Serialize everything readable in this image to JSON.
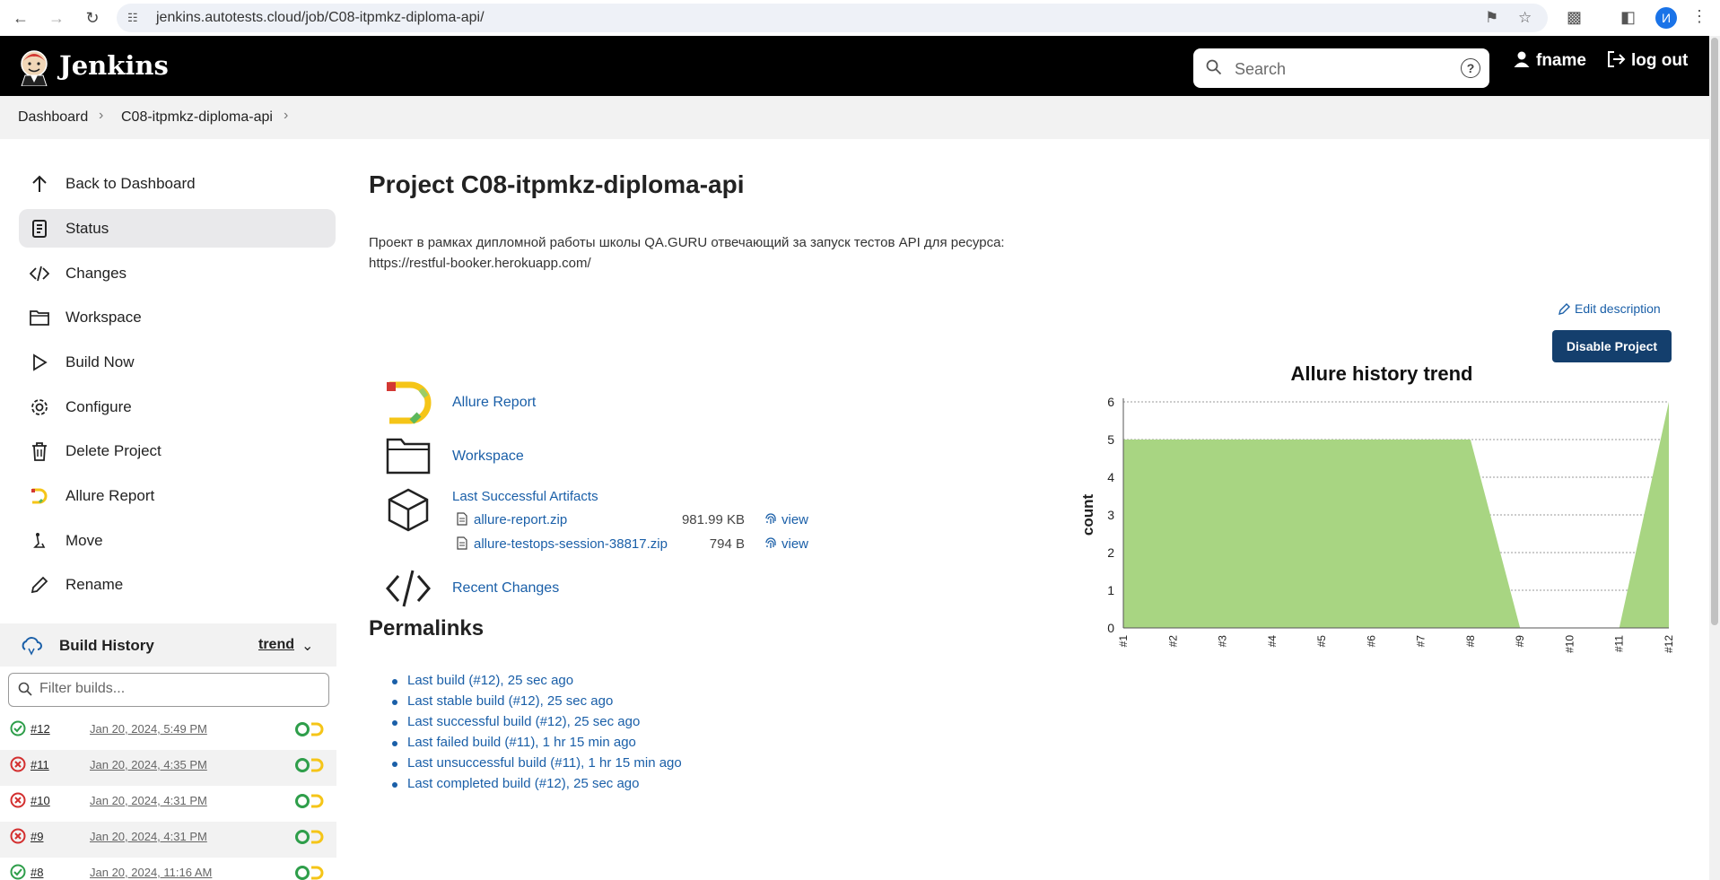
{
  "browser": {
    "url": "jenkins.autotests.cloud/job/C08-itpmkz-diploma-api/",
    "profile_initial": "И"
  },
  "header": {
    "brand": "Jenkins",
    "search_placeholder": "Search",
    "help": "?",
    "user": "fname",
    "logout": "log out"
  },
  "breadcrumb": {
    "items": [
      "Dashboard",
      "C08-itpmkz-diploma-api"
    ]
  },
  "sidebar": {
    "items": [
      {
        "label": "Back to Dashboard",
        "icon": "arrow-up-icon"
      },
      {
        "label": "Status",
        "icon": "status-document-icon"
      },
      {
        "label": "Changes",
        "icon": "code-icon"
      },
      {
        "label": "Workspace",
        "icon": "folder-icon"
      },
      {
        "label": "Build Now",
        "icon": "play-icon"
      },
      {
        "label": "Configure",
        "icon": "gear-icon"
      },
      {
        "label": "Delete Project",
        "icon": "trash-icon"
      },
      {
        "label": "Allure Report",
        "icon": "allure-icon"
      },
      {
        "label": "Move",
        "icon": "move-icon"
      },
      {
        "label": "Rename",
        "icon": "pencil-icon"
      }
    ]
  },
  "build_history": {
    "title": "Build History",
    "trend": "trend",
    "filter_placeholder": "Filter builds...",
    "builds": [
      {
        "num": "#12",
        "date": "Jan 20, 2024, 5:49 PM",
        "status": "success"
      },
      {
        "num": "#11",
        "date": "Jan 20, 2024, 4:35 PM",
        "status": "failed"
      },
      {
        "num": "#10",
        "date": "Jan 20, 2024, 4:31 PM",
        "status": "failed"
      },
      {
        "num": "#9",
        "date": "Jan 20, 2024, 4:31 PM",
        "status": "failed"
      },
      {
        "num": "#8",
        "date": "Jan 20, 2024, 11:16 AM",
        "status": "success"
      }
    ]
  },
  "main": {
    "title": "Project C08-itpmkz-diploma-api",
    "description_line1": "Проект в рамках дипломной работы школы QA.GURU отвечающий за запуск тестов API для ресурса:",
    "description_line2": "https://restful-booker.herokuapp.com/",
    "edit_description": "Edit description",
    "disable_button": "Disable Project",
    "links": {
      "allure_report": "Allure Report",
      "workspace": "Workspace",
      "last_successful_artifacts": "Last Successful Artifacts",
      "recent_changes": "Recent Changes"
    },
    "artifacts": [
      {
        "name": "allure-report.zip",
        "size": "981.99 KB",
        "view": "view"
      },
      {
        "name": "allure-testops-session-38817.zip",
        "size": "794 B",
        "view": "view"
      }
    ],
    "permalinks_title": "Permalinks",
    "permalinks": [
      "Last build (#12), 25 sec ago",
      "Last stable build (#12), 25 sec ago",
      "Last successful build (#12), 25 sec ago",
      "Last failed build (#11), 1 hr 15 min ago",
      "Last unsuccessful build (#11), 1 hr 15 min ago",
      "Last completed build (#12), 25 sec ago"
    ]
  },
  "chart_data": {
    "type": "area",
    "title": "Allure history trend",
    "ylabel": "count",
    "categories": [
      "#1",
      "#2",
      "#3",
      "#4",
      "#5",
      "#6",
      "#7",
      "#8",
      "#9",
      "#10",
      "#11",
      "#12"
    ],
    "series": [
      {
        "values": [
          5,
          5,
          5,
          5,
          5,
          5,
          5,
          5,
          0,
          0,
          0,
          6
        ],
        "color": "#a8d582"
      }
    ],
    "ylim": [
      0,
      6
    ],
    "yticks": [
      0,
      1,
      2,
      3,
      4,
      5,
      6
    ],
    "grid": true
  },
  "colors": {
    "header_bg": "#000000",
    "link": "#1a5fa8",
    "button_bg": "#143f6d",
    "success": "#2e9e4a",
    "failure": "#d32f2f"
  }
}
